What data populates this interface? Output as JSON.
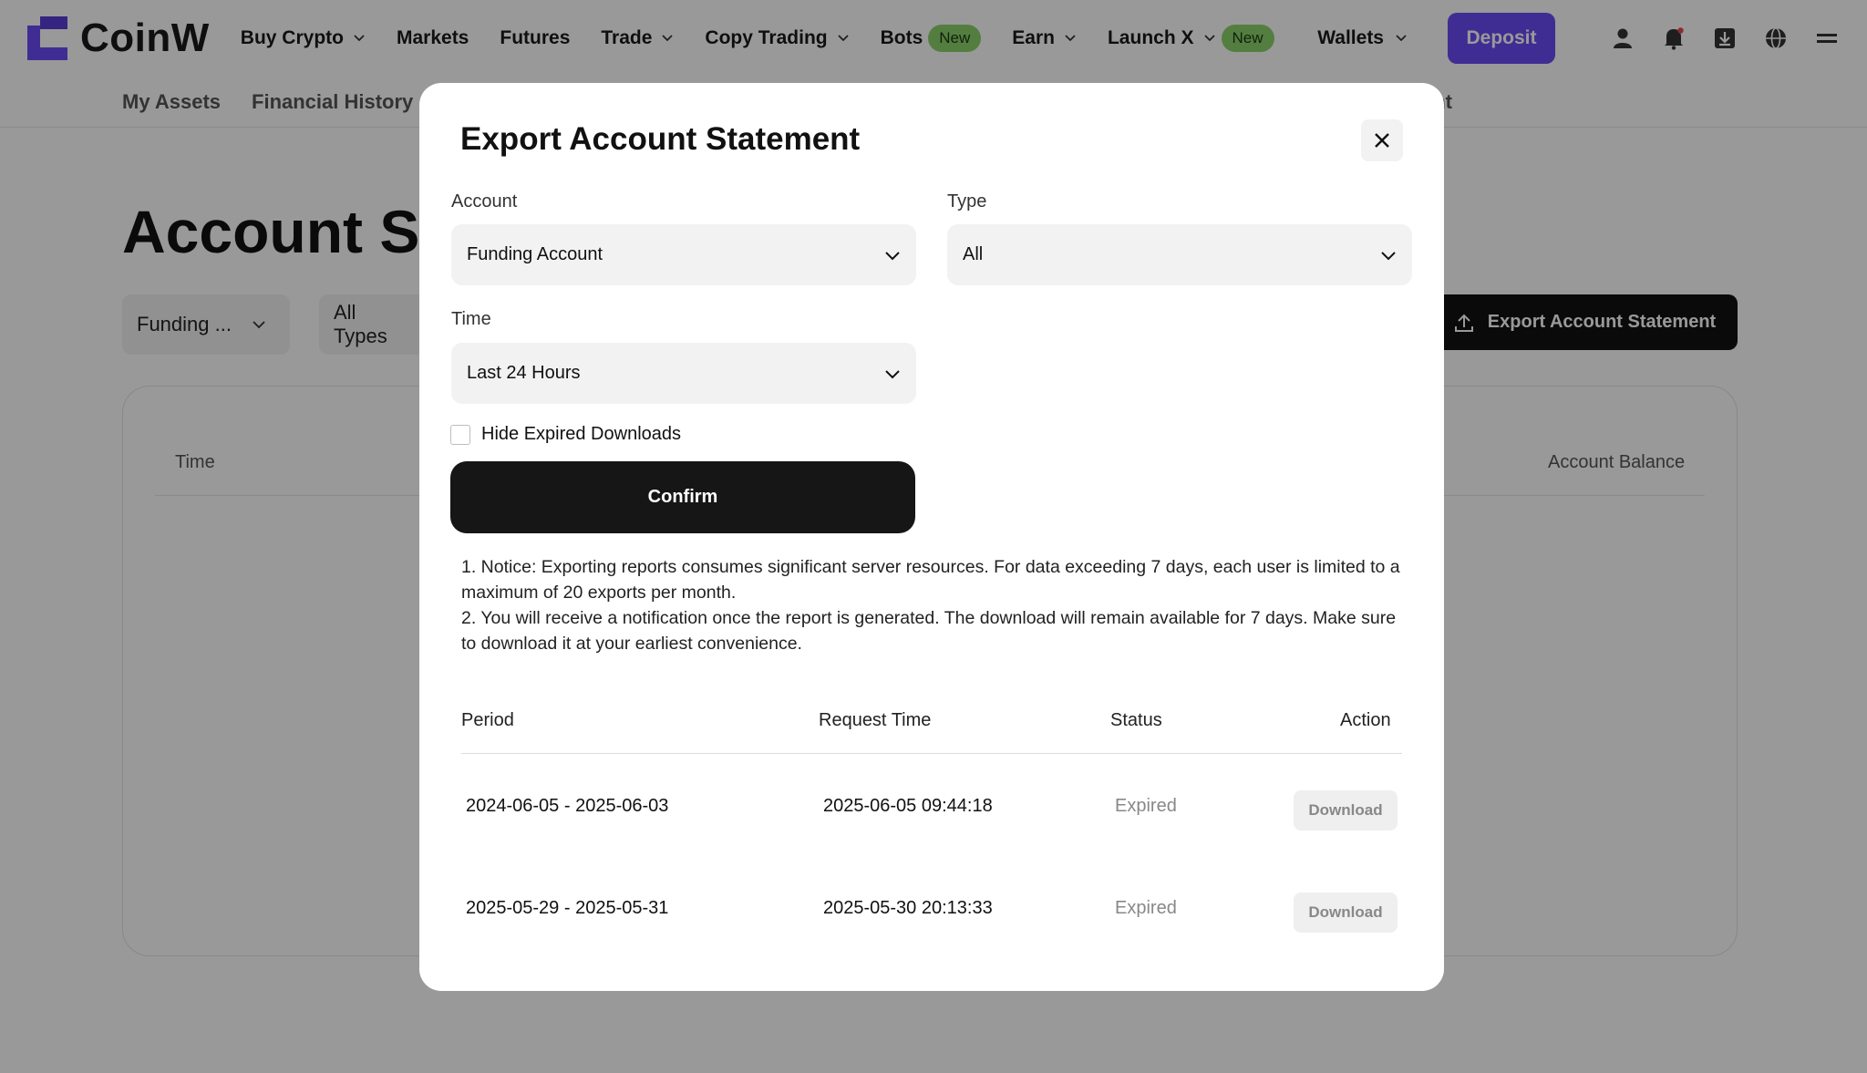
{
  "brand": {
    "name": "CoinW",
    "color": "#6b4cf5"
  },
  "nav": {
    "items": [
      {
        "label": "Buy Crypto",
        "has_chevron": true
      },
      {
        "label": "Markets",
        "has_chevron": false
      },
      {
        "label": "Futures",
        "has_chevron": false
      },
      {
        "label": "Trade",
        "has_chevron": true
      },
      {
        "label": "Copy Trading",
        "has_chevron": true
      },
      {
        "label": "Bots",
        "badge": "New"
      },
      {
        "label": "Earn",
        "has_chevron": true
      },
      {
        "label": "Launch X",
        "has_chevron": true,
        "badge": "New"
      }
    ],
    "wallets": "Wallets",
    "deposit": "Deposit",
    "icons": [
      "user-icon",
      "bell-icon",
      "download-app-icon",
      "globe-icon",
      "menu-icon"
    ]
  },
  "subnav": {
    "items": [
      "My Assets",
      "Financial History"
    ],
    "tail": "ent"
  },
  "page": {
    "title": "Account Sta",
    "filters": [
      "Funding ...",
      "All Types"
    ],
    "export_button": "Export Account Statement",
    "table_headers": {
      "time": "Time",
      "balance": "Account Balance"
    }
  },
  "modal": {
    "title": "Export Account Statement",
    "account": {
      "label": "Account",
      "value": "Funding Account"
    },
    "type": {
      "label": "Type",
      "value": "All"
    },
    "time": {
      "label": "Time",
      "value": "Last 24 Hours"
    },
    "hide_expired": {
      "label": "Hide Expired Downloads",
      "checked": false
    },
    "confirm": "Confirm",
    "notice": [
      "1. Notice: Exporting reports consumes significant server resources. For data exceeding 7 days, each user is limited to a maximum of 20 exports per month.",
      "2. You will receive a notification once the report is generated. The download will remain available for 7 days. Make sure to download it at your earliest convenience."
    ],
    "history": {
      "headers": {
        "period": "Period",
        "request_time": "Request Time",
        "status": "Status",
        "action": "Action"
      },
      "rows": [
        {
          "period": "2024-06-05 - 2025-06-03",
          "request_time": "2025-06-05 09:44:18",
          "status": "Expired",
          "action": "Download"
        },
        {
          "period": "2025-05-29 - 2025-05-31",
          "request_time": "2025-05-30 20:13:33",
          "status": "Expired",
          "action": "Download"
        }
      ]
    }
  }
}
